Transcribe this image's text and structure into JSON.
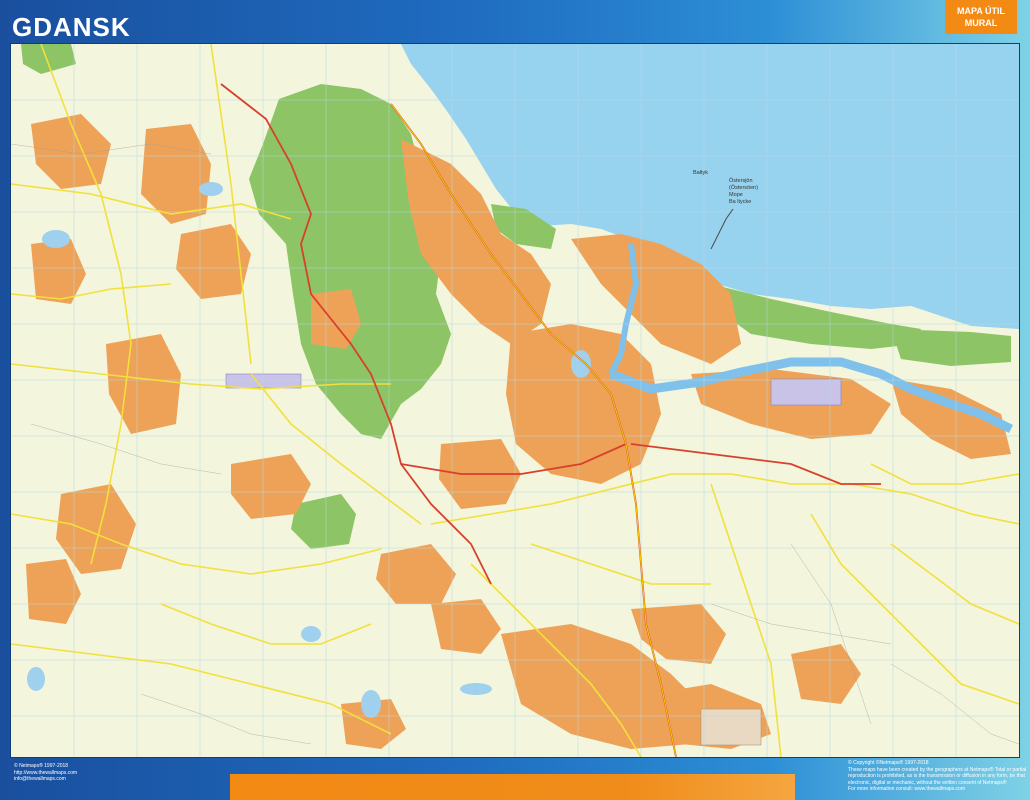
{
  "title": "GDANSK",
  "badge": {
    "line1": "MAPA ÚTIL",
    "line2": "MURAL"
  },
  "sea_labels": [
    "Bałtyk",
    "Östersjön",
    "(Östersöen)",
    "Морe",
    "Ba ltycke"
  ],
  "footer_left": [
    "© Netmaps® 1997-2018",
    "http://www.thewallmaps.com",
    "info@thewallmaps.com"
  ],
  "footer_right": [
    "© Copyright ©Netmaps® 1997-2018",
    "These maps have been created by the geographers at Netmaps® Total or partial",
    "reproduction is prohibited, as is the transmission or diffusion in any form, be that",
    "electronic, digital or mechanic, without the written consent of Netmaps®",
    "For more information consult: www.thewallmaps.com"
  ],
  "colors": {
    "sea": "#97d3ef",
    "land": "#f3f5dc",
    "urban": "#eea257",
    "forest": "#8cc466",
    "road": "#f2e03c",
    "highway": "#d8402e",
    "water": "#9fd0ee",
    "airport": "#c9c3e8",
    "frame": "#1a4f9e",
    "badge": "#f28a14"
  },
  "icons": [
    "map-grid",
    "road-network",
    "river-icon"
  ]
}
